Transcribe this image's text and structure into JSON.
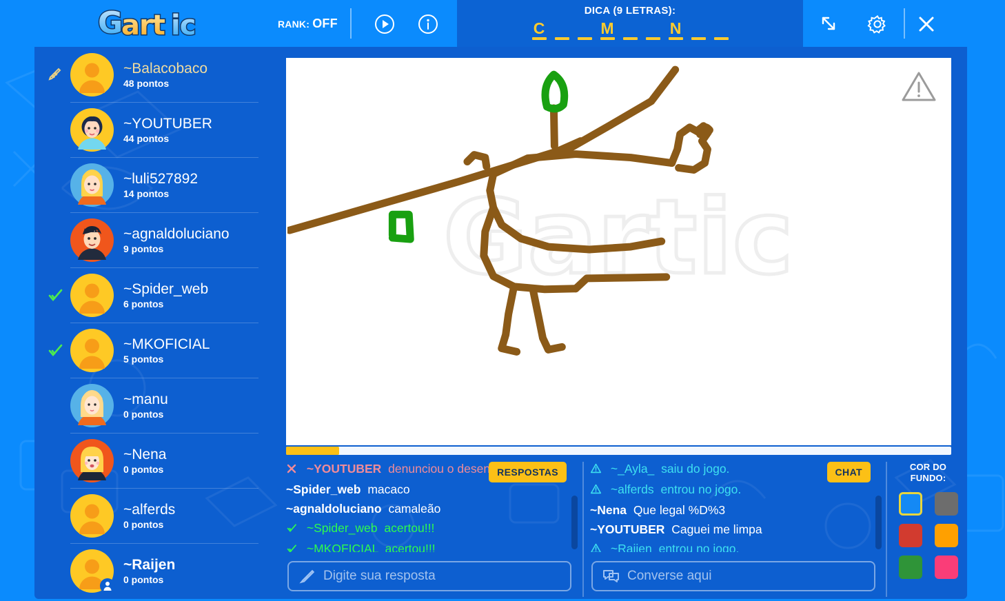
{
  "header": {
    "logo_text": "Gartic",
    "rank_label": "RANK:",
    "rank_value": "OFF",
    "play_icon": "play-circle-icon",
    "info_icon": "info-circle-icon",
    "expand_icon": "expand-icon",
    "settings_icon": "gear-icon",
    "close_icon": "close-icon",
    "hint_label": "DICA (9 LETRAS):",
    "hint_slots": [
      "C",
      "",
      "",
      "M",
      "",
      "",
      "N",
      "",
      ""
    ]
  },
  "players": [
    {
      "name": "~Balacobaco",
      "points": "48 pontos",
      "status": "pencil",
      "role": "drawer",
      "avatar": "default-yellow"
    },
    {
      "name": "~YOUTUBER",
      "points": "44 pontos",
      "status": "",
      "role": "",
      "avatar": "girl-curly"
    },
    {
      "name": "~luli527892",
      "points": "14 pontos",
      "status": "",
      "role": "",
      "avatar": "girl-blonde"
    },
    {
      "name": "~agnaldoluciano",
      "points": "9 pontos",
      "status": "",
      "role": "",
      "avatar": "boy-dark"
    },
    {
      "name": "~Spider_web",
      "points": "6 pontos",
      "status": "check",
      "role": "",
      "avatar": "default-yellow"
    },
    {
      "name": "~MKOFICIAL",
      "points": "5 pontos",
      "status": "check",
      "role": "",
      "avatar": "default-yellow"
    },
    {
      "name": "~manu",
      "points": "0 pontos",
      "status": "",
      "role": "",
      "avatar": "girl-ponytail"
    },
    {
      "name": "~Nena",
      "points": "0 pontos",
      "status": "",
      "role": "",
      "avatar": "girl-bangs"
    },
    {
      "name": "~alferds",
      "points": "0 pontos",
      "status": "",
      "role": "",
      "avatar": "default-yellow"
    },
    {
      "name": "~Raijen",
      "points": "0 pontos",
      "status": "",
      "role": "self",
      "avatar": "default-yellow"
    }
  ],
  "canvas": {
    "report_icon": "warning-triangle-icon",
    "watermark": "Gartic",
    "stroke_brown": "#8b5a18",
    "stroke_green": "#19a011"
  },
  "progress": {
    "percent": 8,
    "fill_color": "#fcc016"
  },
  "answers": {
    "tab_label": "RESPOSTAS",
    "messages": [
      {
        "icon": "report-x-icon",
        "nick": "~YOUTUBER",
        "text": "denunciou o desenho.",
        "kind": "report"
      },
      {
        "icon": "",
        "nick": "~Spider_web",
        "text": "macaco",
        "kind": "normal"
      },
      {
        "icon": "",
        "nick": "~agnaldoluciano",
        "text": "camaleão",
        "kind": "normal"
      },
      {
        "icon": "check-icon",
        "nick": "~Spider_web",
        "text": "acertou!!!",
        "kind": "correct"
      },
      {
        "icon": "check-icon",
        "nick": "~MKOFICIAL",
        "text": "acertou!!!",
        "kind": "correct"
      }
    ],
    "input_placeholder": "Digite sua resposta",
    "input_value": "",
    "input_icon": "pencil-icon"
  },
  "chat": {
    "tab_label": "CHAT",
    "messages": [
      {
        "icon": "alert-icon",
        "nick": "~_Ayla_",
        "text": "saiu do jogo.",
        "kind": "system"
      },
      {
        "icon": "alert-icon",
        "nick": "~alferds",
        "text": "entrou no jogo.",
        "kind": "system"
      },
      {
        "icon": "",
        "nick": "~Nena",
        "text": "Que legal %D%3",
        "kind": "normal"
      },
      {
        "icon": "",
        "nick": "~YOUTUBER",
        "text": "Caguei me limpa",
        "kind": "normal"
      },
      {
        "icon": "alert-icon",
        "nick": "~Raijen",
        "text": "entrou no jogo.",
        "kind": "system"
      }
    ],
    "input_placeholder": "Converse aqui",
    "input_value": "",
    "input_icon": "chat-bubble-icon"
  },
  "palette": {
    "title_line1": "COR DO",
    "title_line2": "FUNDO:",
    "colors": [
      {
        "name": "blue",
        "hex": "#1489f5",
        "selected": true
      },
      {
        "name": "gray",
        "hex": "#6d6d6d",
        "selected": false
      },
      {
        "name": "red",
        "hex": "#d23b2f",
        "selected": false
      },
      {
        "name": "orange",
        "hex": "#ffa000",
        "selected": false
      },
      {
        "name": "green",
        "hex": "#2f9438",
        "selected": false
      },
      {
        "name": "pink",
        "hex": "#fa3d78",
        "selected": false
      }
    ]
  },
  "theme": {
    "bg_outer": "#0b8bfd",
    "bg_panel": "#0d5fd0",
    "accent_yellow": "#fcc016",
    "correct_green": "#2dfb4e",
    "system_cyan": "#3ee0f0"
  }
}
